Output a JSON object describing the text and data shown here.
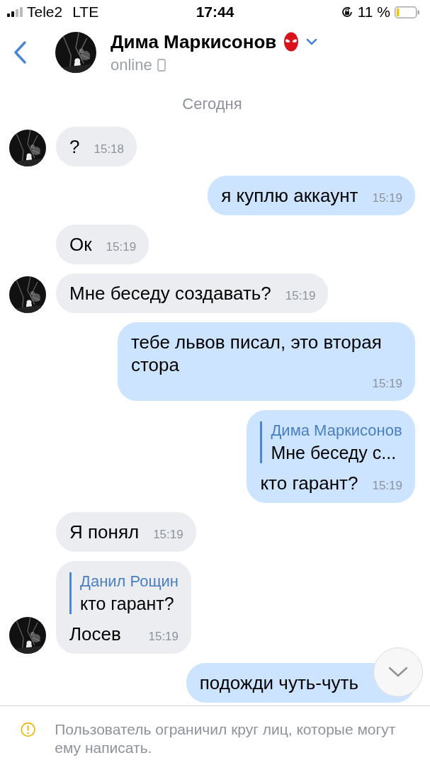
{
  "status_bar": {
    "carrier": "Tele2",
    "network": "LTE",
    "time": "17:44",
    "battery": "11 %"
  },
  "header": {
    "name": "Дима Маркисонов",
    "status": "online"
  },
  "date_label": "Сегодня",
  "messages": [
    {
      "kind": "incoming",
      "avatar": true,
      "text": "?",
      "time": "15:18"
    },
    {
      "kind": "outgoing",
      "text": "я куплю аккаунт",
      "time": "15:19"
    },
    {
      "kind": "incoming",
      "avatar": false,
      "text": "Ок",
      "time": "15:19"
    },
    {
      "kind": "incoming",
      "avatar": true,
      "text": "Мне беседу создавать?",
      "time": "15:19"
    },
    {
      "kind": "outgoing",
      "text": "тебе львов писал, это вторая стора",
      "time": "15:19"
    },
    {
      "kind": "outgoing",
      "reply": {
        "author": "Дима Маркисонов",
        "text": "Мне беседу с..."
      },
      "text": "кто гарант?",
      "time": "15:19"
    },
    {
      "kind": "incoming",
      "avatar": false,
      "text": "Я понял",
      "time": "15:19"
    },
    {
      "kind": "incoming",
      "avatar": true,
      "reply": {
        "author": "Данил Рощин",
        "text": "кто гарант?"
      },
      "text": "Лосев",
      "time": "15:19"
    },
    {
      "kind": "outgoing",
      "text": "подожди чуть-чуть"
    }
  ],
  "footer": {
    "notice": "Пользователь ограничил круг лиц, которые могут ему написать."
  }
}
